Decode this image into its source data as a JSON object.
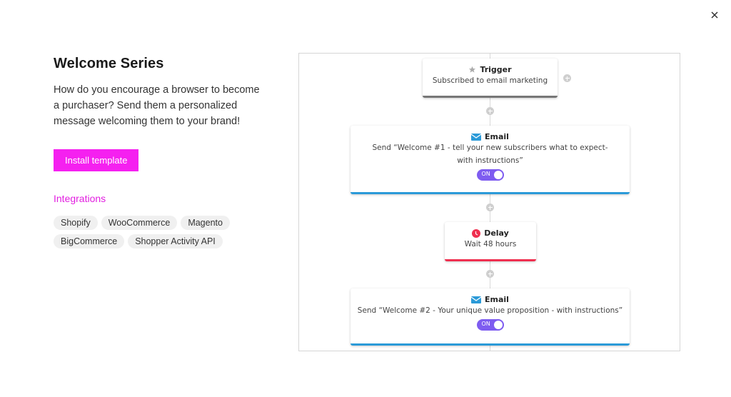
{
  "close_label": "Close",
  "template": {
    "title": "Welcome Series",
    "description": "How do you encourage a browser to become a purchaser? Send them a personalized message welcoming them to your brand!",
    "install_button": "Install template",
    "integrations_label": "Integrations",
    "integrations": [
      "Shopify",
      "WooCommerce",
      "Magento",
      "BigCommerce",
      "Shopper Activity API"
    ]
  },
  "colors": {
    "accent": "#f520f0",
    "email": "#2b9ad8",
    "delay": "#ef2f4f",
    "toggle": "#7e5cf0"
  },
  "flow": {
    "trigger": {
      "icon": "star-icon",
      "title": "Trigger",
      "text": "Subscribed to email marketing"
    },
    "email1": {
      "icon": "envelope-icon",
      "title": "Email",
      "text": "Send “Welcome #1 - tell your new subscribers what to expect- with instructions”",
      "toggle": "ON"
    },
    "delay": {
      "icon": "clock-icon",
      "title": "Delay",
      "text": "Wait 48 hours"
    },
    "email2": {
      "icon": "envelope-icon",
      "title": "Email",
      "text": "Send “Welcome #2 - Your unique value proposition - with instructions”",
      "toggle": "ON"
    }
  }
}
